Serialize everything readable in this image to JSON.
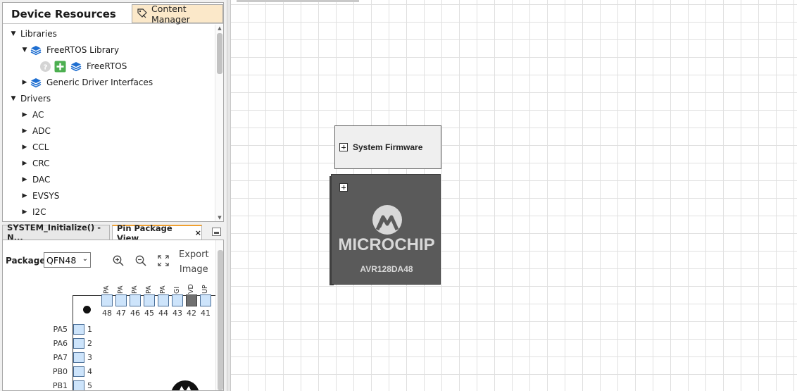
{
  "resources": {
    "title": "Device Resources",
    "content_manager_label": "Content Manager",
    "tree": [
      {
        "label": "Libraries",
        "expanded": true
      },
      {
        "label": "FreeRTOS Library",
        "expanded": true
      },
      {
        "label": "FreeRTOS"
      },
      {
        "label": "Generic Driver Interfaces",
        "expanded": false
      },
      {
        "label": "Drivers",
        "expanded": true
      },
      {
        "label": "AC"
      },
      {
        "label": "ADC"
      },
      {
        "label": "CCL"
      },
      {
        "label": "CRC"
      },
      {
        "label": "DAC"
      },
      {
        "label": "EVSYS"
      },
      {
        "label": "I2C"
      }
    ]
  },
  "tabs": [
    {
      "label": "SYSTEM_Initialize() - N..."
    },
    {
      "label": "Pin Package View",
      "close": "×"
    }
  ],
  "pin_view": {
    "package_label": "Package:",
    "package_value": "QFN48",
    "export_line1": "Export",
    "export_line2": "Image",
    "top_pins": [
      {
        "name": "PA",
        "num": "48"
      },
      {
        "name": "PA",
        "num": "47"
      },
      {
        "name": "PA",
        "num": "46"
      },
      {
        "name": "PA",
        "num": "45"
      },
      {
        "name": "PA",
        "num": "44"
      },
      {
        "name": "GI",
        "num": "43"
      },
      {
        "name": "VD",
        "num": "42"
      },
      {
        "name": "UP",
        "num": "41"
      }
    ],
    "side_pins": [
      {
        "name": "PA5",
        "num": "1"
      },
      {
        "name": "PA6",
        "num": "2"
      },
      {
        "name": "PA7",
        "num": "3"
      },
      {
        "name": "PB0",
        "num": "4"
      },
      {
        "name": "PB1",
        "num": "5"
      }
    ]
  },
  "canvas": {
    "system_firmware_label": "System Firmware",
    "chip_brand": "MICROCHIP",
    "chip_model": "AVR128DA48"
  },
  "colors": {
    "accent_tab": "#f0a030",
    "content_manager_bg": "#fbe8c9",
    "pin_fill": "#cde4fb",
    "chip_body": "#5a5a5a",
    "library_icon": "#1f6fd1",
    "add_button": "#4caf50"
  }
}
